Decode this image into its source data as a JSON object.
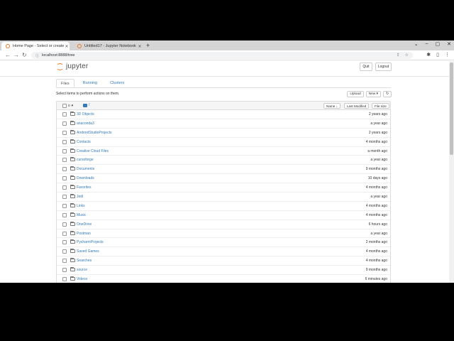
{
  "browser": {
    "tabs": [
      {
        "title": "Home Page - Select or create a",
        "active": true
      },
      {
        "title": "Untitled17 - Jupyter Notebook",
        "active": false
      }
    ],
    "new_tab": "+",
    "window_controls": {
      "minimize": "⌄",
      "restore": "–",
      "maximize": "▢",
      "close": "✕"
    },
    "url": "localhost:8888/tree",
    "nav": {
      "back": "←",
      "forward": "→",
      "reload": "↻"
    }
  },
  "jupyter": {
    "logo_text": "jupyter",
    "quit_label": "Quit",
    "logout_label": "Logout",
    "tabs": [
      "Files",
      "Running",
      "Clusters"
    ],
    "hint": "Select items to perform actions on them.",
    "upload_label": "Upload",
    "new_label": "New ▾",
    "refresh": "↻",
    "list_header": {
      "select_count": "0",
      "breadcrumb": "/",
      "sort_name": "Name ↓",
      "sort_modified": "Last Modified",
      "sort_size": "File size"
    },
    "files": [
      {
        "name": "3D Objects",
        "modified": "2 years ago"
      },
      {
        "name": "anaconda3",
        "modified": "a year ago"
      },
      {
        "name": "AndroidStudioProjects",
        "modified": "2 years ago"
      },
      {
        "name": "Contacts",
        "modified": "4 months ago"
      },
      {
        "name": "Creative Cloud Files",
        "modified": "a month ago"
      },
      {
        "name": "cursoforge",
        "modified": "a year ago"
      },
      {
        "name": "Documents",
        "modified": "9 months ago"
      },
      {
        "name": "Downloads",
        "modified": "10 days ago"
      },
      {
        "name": "Favorites",
        "modified": "4 months ago"
      },
      {
        "name": "Jedi",
        "modified": "a year ago"
      },
      {
        "name": "Links",
        "modified": "4 months ago"
      },
      {
        "name": "Music",
        "modified": "4 months ago"
      },
      {
        "name": "OneDrive",
        "modified": "6 hours ago"
      },
      {
        "name": "Postman",
        "modified": "a year ago"
      },
      {
        "name": "PycharmProjects",
        "modified": "2 months ago"
      },
      {
        "name": "Saved Games",
        "modified": "4 months ago"
      },
      {
        "name": "Searches",
        "modified": "4 months ago"
      },
      {
        "name": "source",
        "modified": "9 months ago"
      },
      {
        "name": "Videos",
        "modified": "6 minutes ago"
      }
    ]
  },
  "colors": {
    "accent": "#f37726",
    "link": "#337ab7"
  }
}
